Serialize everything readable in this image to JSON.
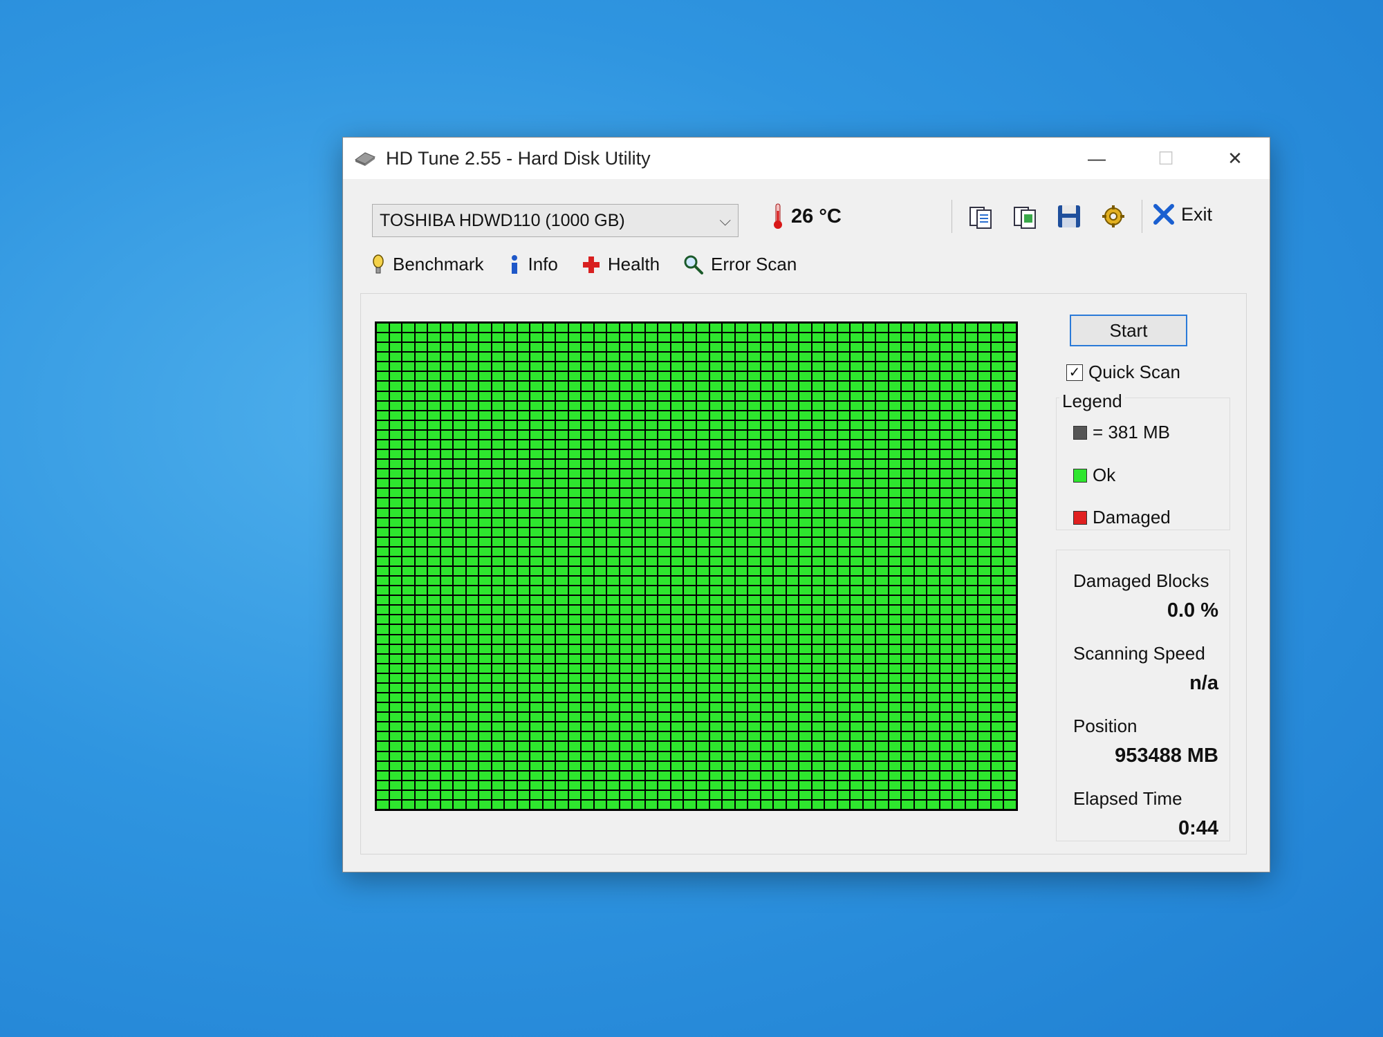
{
  "window": {
    "title": "HD Tune 2.55 - Hard Disk Utility",
    "controls": {
      "minimize": "—",
      "maximize": "☐",
      "close": "✕"
    }
  },
  "toolbar": {
    "drive": "TOSHIBA HDWD110 (1000 GB)",
    "temperature": "26 °C",
    "tools": [
      "copy-text-icon",
      "copy-screenshot-icon",
      "save-icon",
      "options-icon"
    ],
    "exit_label": "Exit"
  },
  "tabs": [
    {
      "label": "Benchmark",
      "icon": "benchmark-icon"
    },
    {
      "label": "Info",
      "icon": "info-icon"
    },
    {
      "label": "Health",
      "icon": "health-icon"
    },
    {
      "label": "Error Scan",
      "icon": "magnifier-icon"
    }
  ],
  "scan": {
    "start_label": "Start",
    "quick_scan_label": "Quick Scan",
    "quick_scan_checked": true,
    "legend_title": "Legend",
    "legend": [
      {
        "label": "= 381 MB",
        "color": "#555555"
      },
      {
        "label": "Ok",
        "color": "#2ee62e"
      },
      {
        "label": "Damaged",
        "color": "#e02020"
      }
    ],
    "grid_columns": 50,
    "grid_rows": 50,
    "block_status": "Ok"
  },
  "stats": {
    "damaged_blocks_label": "Damaged Blocks",
    "damaged_blocks_value": "0.0 %",
    "scanning_speed_label": "Scanning Speed",
    "scanning_speed_value": "n/a",
    "position_label": "Position",
    "position_value": "953488 MB",
    "elapsed_label": "Elapsed Time",
    "elapsed_value": "0:44"
  }
}
